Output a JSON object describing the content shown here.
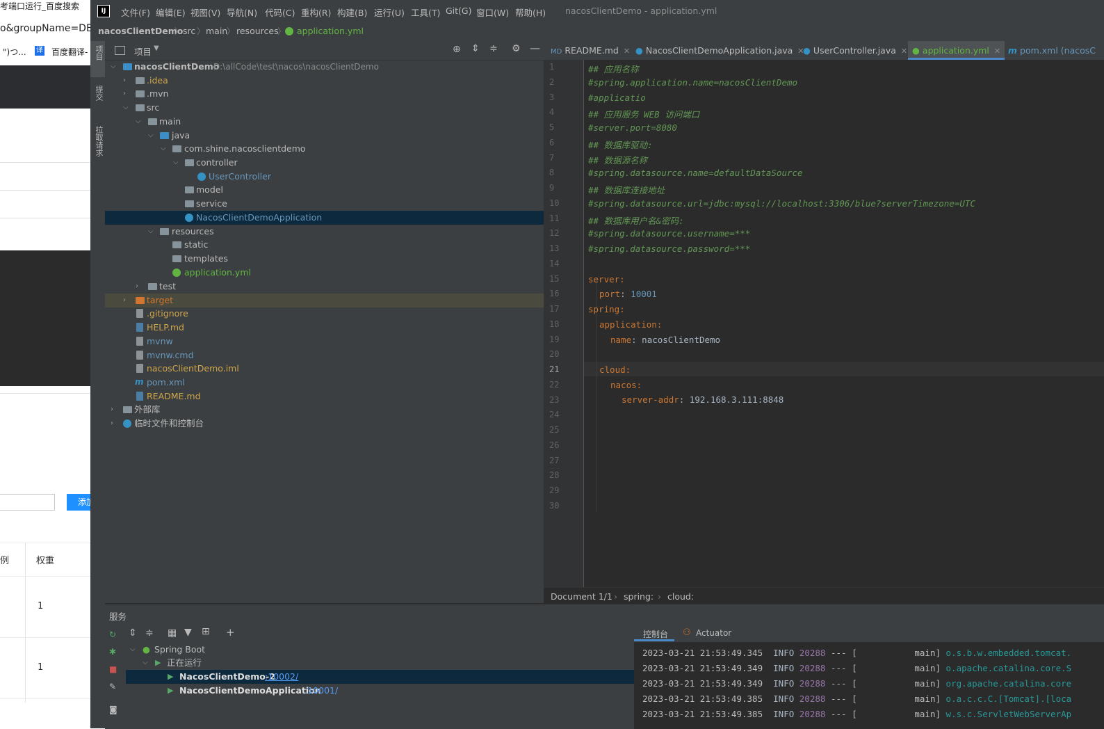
{
  "browser": {
    "title": "考端口运行_百度搜索",
    "url": "o&groupName=DEF",
    "bookmark1": "\")つ...",
    "bookmark2": "百度翻译-",
    "add_button": "添加",
    "col1": "例",
    "col2": "权重",
    "weight1": "1",
    "weight2": "1"
  },
  "ide": {
    "window_title": "nacosClientDemo - application.yml",
    "menu": [
      "文件(F)",
      "编辑(E)",
      "视图(V)",
      "导航(N)",
      "代码(C)",
      "重构(R)",
      "构建(B)",
      "运行(U)",
      "工具(T)",
      "Git(G)",
      "窗口(W)",
      "帮助(H)"
    ],
    "breadcrumb": [
      "nacosClientDemo",
      "src",
      "main",
      "resources",
      "application.yml"
    ],
    "left_tabs": [
      "项目",
      "提交",
      "拉取请求"
    ]
  },
  "project": {
    "header_label": "项目",
    "root_name": "nacosClientDemo",
    "root_path": "D:\\allCode\\test\\nacos\\nacosClientDemo",
    "items": [
      ".idea",
      ".mvn",
      "src",
      "main",
      "java",
      "com.shine.nacosclientdemo",
      "controller",
      "UserController",
      "model",
      "service",
      "NacosClientDemoApplication",
      "resources",
      "static",
      "templates",
      "application.yml",
      "test",
      "target",
      ".gitignore",
      "HELP.md",
      "mvnw",
      "mvnw.cmd",
      "nacosClientDemo.iml",
      "pom.xml",
      "README.md",
      "外部库",
      "临时文件和控制台"
    ]
  },
  "editor": {
    "tabs": [
      "README.md",
      "NacosClientDemoApplication.java",
      "UserController.java",
      "application.yml",
      "pom.xml (nacosC"
    ],
    "lines": [
      "## 应用名称",
      "#spring.application.name=nacosClientDemo",
      "#applicatio",
      "## 应用服务 WEB 访问端口",
      "#server.port=8080",
      "## 数据库驱动:",
      "## 数据源名称",
      "#spring.datasource.name=defaultDataSource",
      "## 数据库连接地址",
      "#spring.datasource.url=jdbc:mysql://localhost:3306/blue?serverTimezone=UTC",
      "## 数据库用户名&密码:",
      "#spring.datasource.username=***",
      "#spring.datasource.password=***",
      "",
      "server:",
      "port",
      "spring:",
      "application:",
      "name",
      "",
      "cloud:",
      "nacos:",
      "server-addr"
    ],
    "port_value": "10001",
    "name_value": "nacosClientDemo",
    "addr_value": "192.168.3.111:8848",
    "line_numbers": [
      "1",
      "2",
      "3",
      "4",
      "5",
      "6",
      "7",
      "8",
      "9",
      "10",
      "11",
      "12",
      "13",
      "14",
      "15",
      "16",
      "17",
      "18",
      "19",
      "20",
      "21",
      "22",
      "23",
      "24",
      "25",
      "26",
      "27",
      "28",
      "29",
      "30"
    ],
    "status": [
      "Document 1/1",
      "spring:",
      "cloud:"
    ]
  },
  "services": {
    "title": "服务",
    "console_tab": "控制台",
    "actuator_tab": "Actuator",
    "spring_boot": "Spring Boot",
    "running": "正在运行",
    "app1": "NacosClientDemo-2",
    "app1_port": ":10002/",
    "app2": "NacosClientDemoApplication",
    "app2_port": ":10001/",
    "logs": [
      {
        "ts": "2023-03-21 21:53:49.345",
        "lvl": "INFO",
        "pid": "20288",
        "cls": "o.s.b.w.embedded.tomcat."
      },
      {
        "ts": "2023-03-21 21:53:49.349",
        "lvl": "INFO",
        "pid": "20288",
        "cls": "o.apache.catalina.core.S"
      },
      {
        "ts": "2023-03-21 21:53:49.349",
        "lvl": "INFO",
        "pid": "20288",
        "cls": "org.apache.catalina.core"
      },
      {
        "ts": "2023-03-21 21:53:49.385",
        "lvl": "INFO",
        "pid": "20288",
        "cls": "o.a.c.c.C.[Tomcat].[loca"
      },
      {
        "ts": "2023-03-21 21:53:49.385",
        "lvl": "INFO",
        "pid": "20288",
        "cls": "w.s.c.ServletWebServerAp"
      }
    ]
  }
}
